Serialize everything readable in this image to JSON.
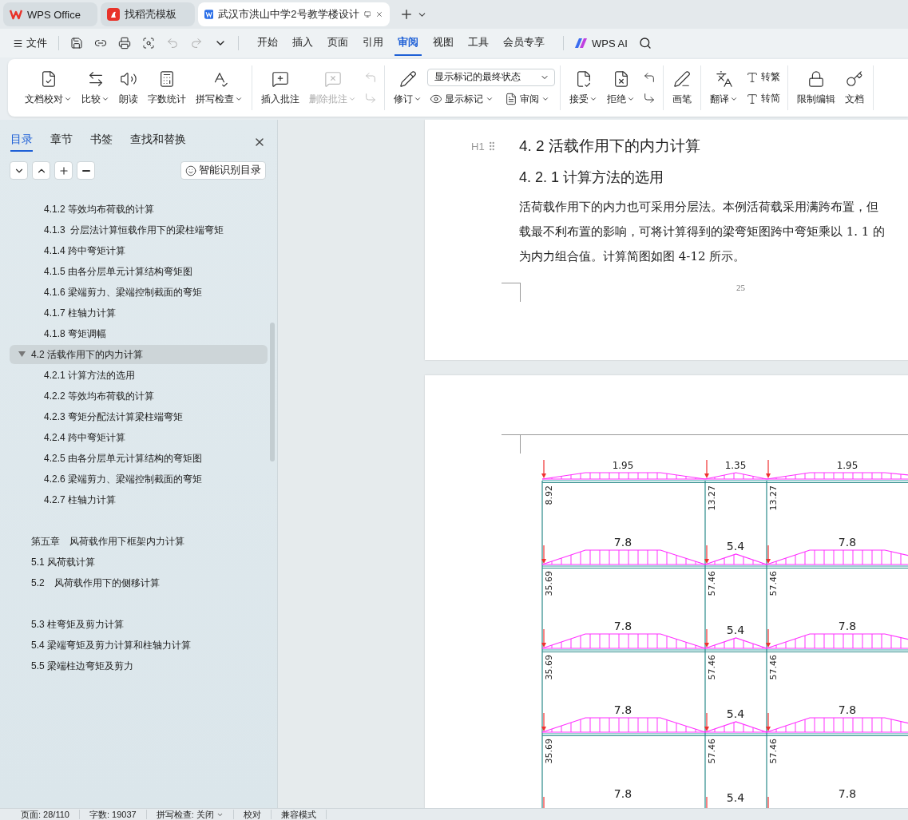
{
  "tabs": [
    {
      "kind": "home",
      "label": "WPS Office",
      "selected": false
    },
    {
      "kind": "template",
      "label": "找稻壳模板",
      "selected": false
    },
    {
      "kind": "document",
      "label": "武汉市洪山中学2号教学楼设计",
      "selected": true
    }
  ],
  "menu": {
    "file": "文件",
    "items": [
      {
        "label": "开始",
        "selected": false
      },
      {
        "label": "插入",
        "selected": false
      },
      {
        "label": "页面",
        "selected": false
      },
      {
        "label": "引用",
        "selected": false
      },
      {
        "label": "审阅",
        "selected": true
      },
      {
        "label": "视图",
        "selected": false
      },
      {
        "label": "工具",
        "selected": false
      },
      {
        "label": "会员专享",
        "selected": false
      }
    ],
    "ai": "WPS AI"
  },
  "ribbon": {
    "groups": [
      {
        "items": [
          {
            "kind": "large",
            "label": "文档校对",
            "dropdown": true,
            "disabled": false
          },
          {
            "kind": "large",
            "label": "比较",
            "dropdown": true,
            "disabled": false
          },
          {
            "kind": "large",
            "label": "朗读",
            "dropdown": false,
            "disabled": false
          },
          {
            "kind": "large",
            "label": "字数统计",
            "dropdown": false,
            "disabled": false
          },
          {
            "kind": "large",
            "label": "拼写检查",
            "dropdown": true,
            "disabled": false
          }
        ]
      },
      {
        "items": [
          {
            "kind": "large",
            "label": "插入批注",
            "dropdown": false,
            "disabled": false
          },
          {
            "kind": "large",
            "label": "删除批注",
            "dropdown": true,
            "disabled": true
          },
          {
            "kind": "stack",
            "rows": [
              [
                {
                  "kind": "small",
                  "dropdown": false,
                  "disabled": true
                }
              ],
              [
                {
                  "kind": "small",
                  "dropdown": false,
                  "disabled": true
                }
              ]
            ]
          }
        ]
      },
      {
        "items": [
          {
            "kind": "large",
            "label": "修订",
            "dropdown": true,
            "disabled": false
          },
          {
            "kind": "stack",
            "rows": [
              [
                {
                  "kind": "select",
                  "value": "显示标记的最终状态"
                }
              ],
              [
                {
                  "kind": "small",
                  "label": "显示标记",
                  "dropdown": true,
                  "disabled": false
                },
                {
                  "kind": "small",
                  "label": "审阅",
                  "dropdown": true,
                  "disabled": false
                }
              ]
            ]
          }
        ]
      },
      {
        "items": [
          {
            "kind": "large",
            "label": "接受",
            "dropdown": true,
            "disabled": false
          },
          {
            "kind": "large",
            "label": "拒绝",
            "dropdown": true,
            "disabled": false
          },
          {
            "kind": "stack",
            "rows": [
              [
                {
                  "kind": "small",
                  "dropdown": false,
                  "disabled": false
                }
              ],
              [
                {
                  "kind": "small",
                  "dropdown": false,
                  "disabled": false
                }
              ]
            ]
          }
        ]
      },
      {
        "items": [
          {
            "kind": "large",
            "label": "画笔",
            "dropdown": false,
            "disabled": false
          }
        ]
      },
      {
        "items": [
          {
            "kind": "large",
            "label": "翻译",
            "dropdown": true,
            "disabled": false
          },
          {
            "kind": "stack",
            "rows": [
              [
                {
                  "kind": "small",
                  "label": "转繁",
                  "dropdown": false,
                  "disabled": false
                }
              ],
              [
                {
                  "kind": "small",
                  "label": "转简",
                  "dropdown": false,
                  "disabled": false
                }
              ]
            ]
          }
        ]
      },
      {
        "items": [
          {
            "kind": "large",
            "label": "限制编辑",
            "dropdown": false,
            "disabled": false
          },
          {
            "kind": "large",
            "label": "文档",
            "dropdown": false,
            "disabled": false
          }
        ]
      }
    ]
  },
  "sidebar": {
    "tabs": [
      {
        "label": "目录",
        "selected": true
      },
      {
        "label": "章节",
        "selected": false
      },
      {
        "label": "书签",
        "selected": false
      },
      {
        "label": "查找和替换",
        "selected": false
      }
    ],
    "smart_button": "智能识别目录",
    "outline": [
      {
        "children": [
          {
            "label": "4.1.2 等效均布荷载的计算",
            "selected": false
          },
          {
            "label": "4.1.3  分层法计算恒载作用下的梁柱端弯矩",
            "selected": false
          },
          {
            "label": "4.1.4 跨中弯矩计算",
            "selected": false
          },
          {
            "label": "4.1.5 由各分层单元计算结构弯矩图",
            "selected": false
          },
          {
            "label": "4.1.6 梁端剪力、梁端控制截面的弯矩",
            "selected": false
          },
          {
            "label": "4.1.7 柱轴力计算",
            "selected": false
          },
          {
            "label": "4.1.8 弯矩调幅",
            "selected": false
          }
        ]
      },
      {
        "label": "4.2 活载作用下的内力计算",
        "selected": true,
        "expanded": true,
        "gap_before": false,
        "children": [
          {
            "label": "4.2.1 计算方法的选用",
            "selected": false
          },
          {
            "label": "4.2.2 等效均布荷载的计算",
            "selected": false
          },
          {
            "label": "4.2.3 弯矩分配法计算梁柱端弯矩",
            "selected": false
          },
          {
            "label": "4.2.4 跨中弯矩计算",
            "selected": false
          },
          {
            "label": "4.2.5 由各分层单元计算结构的弯矩图",
            "selected": false
          },
          {
            "label": "4.2.6 梁端剪力、梁端控制截面的弯矩",
            "selected": false
          },
          {
            "label": "4.2.7 柱轴力计算",
            "selected": false
          }
        ]
      },
      {
        "label": "第五章　风荷载作用下框架内力计算",
        "selected": false,
        "gap_before": true
      },
      {
        "label": "5.1 风荷载计算",
        "selected": false,
        "gap_before": false
      },
      {
        "label": "5.2　风荷载作用下的侧移计算",
        "selected": false,
        "gap_before": false
      },
      {
        "label": "5.3 柱弯矩及剪力计算",
        "selected": false,
        "gap_before": true
      },
      {
        "label": "5.4 梁端弯矩及剪力计算和柱轴力计算",
        "selected": false,
        "gap_before": false
      },
      {
        "label": "5.5 梁端柱边弯矩及剪力",
        "selected": false,
        "gap_before": false
      }
    ]
  },
  "document": {
    "heading_marker": "H1",
    "heading": "4. 2 活载作用下的内力计算",
    "subheading": "4. 2. 1 计算方法的选用",
    "paragraph_lines": [
      "活荷载作用下的内力也可采用分层法。本例活荷载采用满跨布置，但",
      "载最不利布置的影响，可将计算得到的梁弯矩图跨中弯矩乘以 1. 1 的",
      "为内力组合值。计算简图如图 4-12 所示。"
    ],
    "page_number": "25",
    "figure": {
      "floors": [
        {
          "kind": "roof",
          "loads": [
            "1.95",
            "1.35",
            "1.95"
          ],
          "column_values": [
            "8.92",
            "13.27",
            "13.27"
          ]
        },
        {
          "kind": "floor",
          "loads": [
            "7.8",
            "5.4",
            "7.8"
          ],
          "column_values": [
            "35.69",
            "57.46",
            "57.46"
          ]
        },
        {
          "kind": "floor",
          "loads": [
            "7.8",
            "5.4",
            "7.8"
          ],
          "column_values": [
            "35.69",
            "57.46",
            "57.46"
          ]
        },
        {
          "kind": "floor",
          "loads": [
            "7.8",
            "5.4",
            "7.8"
          ],
          "column_values": [
            "35.69",
            "57.46",
            "57.46"
          ]
        },
        {
          "kind": "edge",
          "loads": [
            "7.8",
            "5.4",
            "7.8"
          ]
        }
      ]
    }
  },
  "status_bar": [
    {
      "label": "页面: 28/110",
      "dropdown": false
    },
    {
      "label": "字数: 19037",
      "dropdown": false
    },
    {
      "label": "拼写检查: 关闭",
      "dropdown": true
    },
    {
      "label": "校对",
      "dropdown": false
    },
    {
      "label": "兼容模式",
      "dropdown": false
    }
  ]
}
